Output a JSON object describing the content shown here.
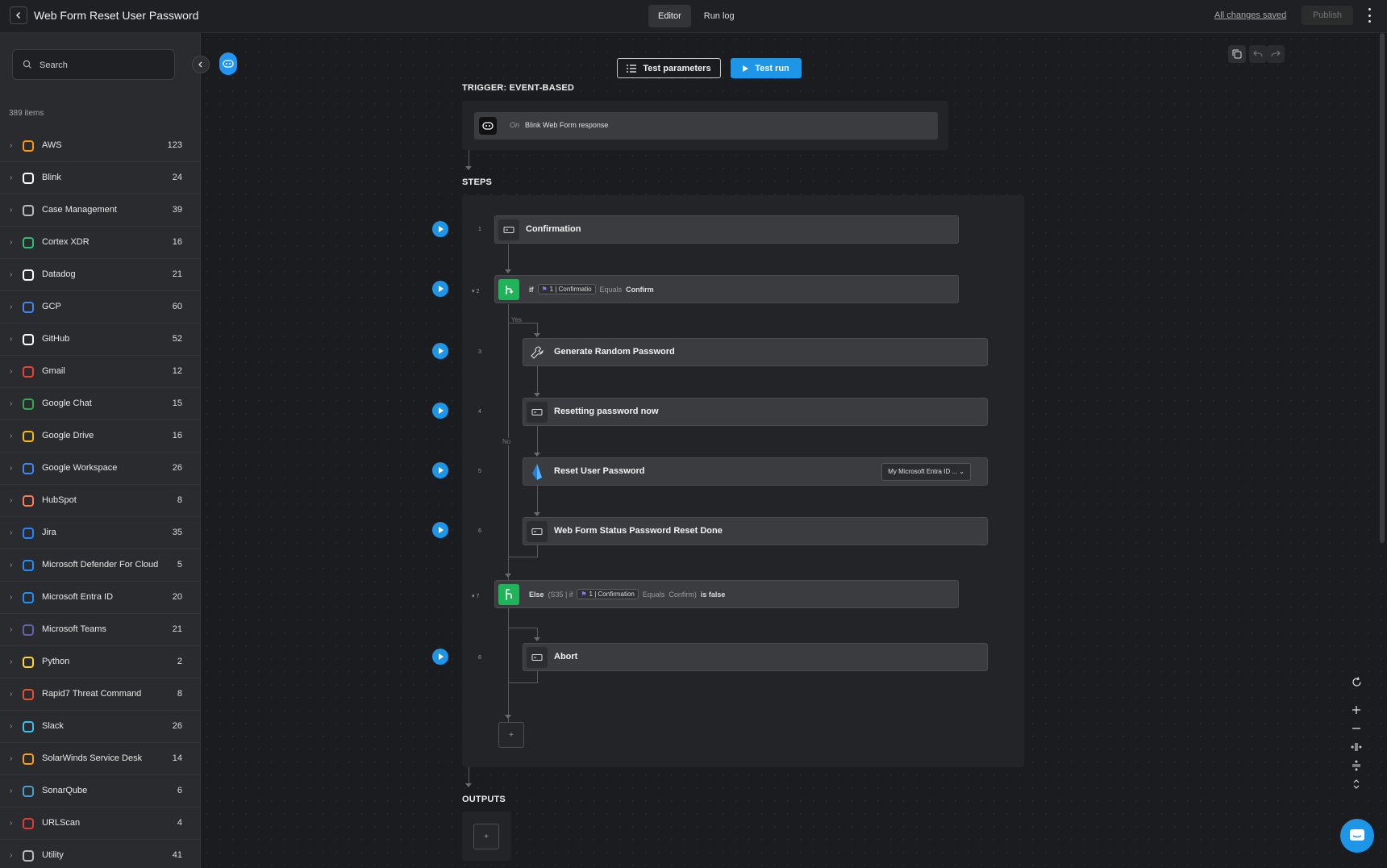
{
  "header": {
    "title": "Web Form Reset User Password",
    "tabs": [
      {
        "label": "Editor",
        "active": true
      },
      {
        "label": "Run log",
        "active": false
      }
    ],
    "saved_status": "All changes saved",
    "publish_label": "Publish"
  },
  "sidebar": {
    "search_placeholder": "Search",
    "items_count": "389 items",
    "categories": [
      {
        "label": "AWS",
        "count": "123",
        "icon": "aws-icon",
        "color": "#ff9900"
      },
      {
        "label": "Blink",
        "count": "24",
        "icon": "blink-icon",
        "color": "#ffffff"
      },
      {
        "label": "Case Management",
        "count": "39",
        "icon": "clipboard-icon",
        "color": "#bbbbbb"
      },
      {
        "label": "Cortex XDR",
        "count": "16",
        "icon": "cortex-xdr-icon",
        "color": "#2fbf71"
      },
      {
        "label": "Datadog",
        "count": "21",
        "icon": "datadog-icon",
        "color": "#ffffff"
      },
      {
        "label": "GCP",
        "count": "60",
        "icon": "gcp-icon",
        "color": "#4285f4"
      },
      {
        "label": "GitHub",
        "count": "52",
        "icon": "github-icon",
        "color": "#ffffff"
      },
      {
        "label": "Gmail",
        "count": "12",
        "icon": "gmail-icon",
        "color": "#ea4335"
      },
      {
        "label": "Google Chat",
        "count": "15",
        "icon": "google-chat-icon",
        "color": "#34a853"
      },
      {
        "label": "Google Drive",
        "count": "16",
        "icon": "google-drive-icon",
        "color": "#fbbc04"
      },
      {
        "label": "Google Workspace",
        "count": "26",
        "icon": "google-icon",
        "color": "#4285f4"
      },
      {
        "label": "HubSpot",
        "count": "8",
        "icon": "hubspot-icon",
        "color": "#ff7a59"
      },
      {
        "label": "Jira",
        "count": "35",
        "icon": "jira-icon",
        "color": "#2684ff"
      },
      {
        "label": "Microsoft Defender For Cloud",
        "count": "5",
        "icon": "shield-icon",
        "color": "#1e90ff"
      },
      {
        "label": "Microsoft Entra ID",
        "count": "20",
        "icon": "entra-id-icon",
        "color": "#1e90ff"
      },
      {
        "label": "Microsoft Teams",
        "count": "21",
        "icon": "teams-icon",
        "color": "#6264a7"
      },
      {
        "label": "Python",
        "count": "2",
        "icon": "python-icon",
        "color": "#ffd43b"
      },
      {
        "label": "Rapid7 Threat Command",
        "count": "8",
        "icon": "rapid7-icon",
        "color": "#e8532f"
      },
      {
        "label": "Slack",
        "count": "26",
        "icon": "slack-icon",
        "color": "#36c5f0"
      },
      {
        "label": "SolarWinds Service Desk",
        "count": "14",
        "icon": "solarwinds-icon",
        "color": "#f99d1c"
      },
      {
        "label": "SonarQube",
        "count": "6",
        "icon": "sonarqube-icon",
        "color": "#4e9bcd"
      },
      {
        "label": "URLScan",
        "count": "4",
        "icon": "urlscan-icon",
        "color": "#e53935"
      },
      {
        "label": "Utility",
        "count": "41",
        "icon": "wrench-icon",
        "color": "#bbbbbb"
      }
    ]
  },
  "toolbar": {
    "test_parameters": "Test parameters",
    "test_run": "Test run"
  },
  "trigger": {
    "section_label": "TRIGGER: EVENT-BASED",
    "on_label": "On",
    "text": "Blink Web Form response"
  },
  "steps": {
    "section_label": "STEPS",
    "branch_yes": "Yes",
    "branch_no": "No",
    "items": [
      {
        "num": "1",
        "title": "Confirmation",
        "icon": "form-icon"
      },
      {
        "num": "2",
        "title": "if",
        "icon": "branch-icon",
        "chip": "1 | Confirmatio",
        "op": "Equals",
        "value": "Confirm"
      },
      {
        "num": "3",
        "title": "Generate Random Password",
        "icon": "wrench-icon"
      },
      {
        "num": "4",
        "title": "Resetting password now",
        "icon": "form-icon"
      },
      {
        "num": "5",
        "title": "Reset User Password",
        "icon": "entra-id-icon",
        "connection": "My Microsoft Entra ID ..."
      },
      {
        "num": "6",
        "title": "Web Form Status Password Reset Done",
        "icon": "form-icon"
      },
      {
        "num": "7",
        "title": "Else",
        "icon": "branch-icon",
        "prefix": "(S35 | if",
        "chip": "1 | Confirmation",
        "op": "Equals",
        "value": "Confirm)",
        "suffix": "is false"
      },
      {
        "num": "8",
        "title": "Abort",
        "icon": "form-icon"
      }
    ],
    "add_label": "+"
  },
  "outputs": {
    "section_label": "OUTPUTS",
    "add_label": "+"
  },
  "colors": {
    "accent": "#1e96e8",
    "branch_green": "#21b35a",
    "background": "#1b1c1f"
  }
}
